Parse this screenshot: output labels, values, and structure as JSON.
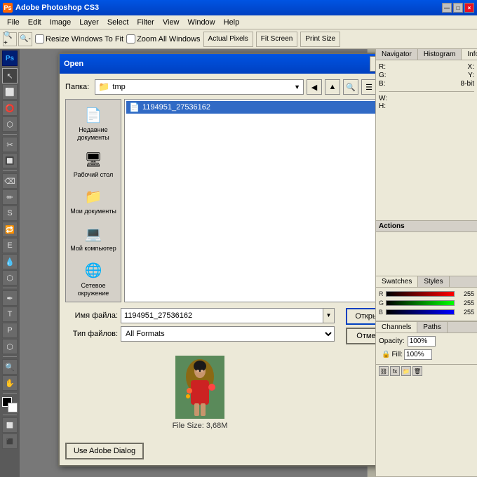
{
  "window": {
    "title": "Adobe Photoshop CS3",
    "close": "×",
    "minimize": "—",
    "maximize": "□"
  },
  "menu": {
    "items": [
      "File",
      "Edit",
      "Image",
      "Layer",
      "Select",
      "Filter",
      "View",
      "Window",
      "Help"
    ]
  },
  "toolbar": {
    "zoom_options": [
      "Resize Windows To Fit",
      "Zoom All Windows"
    ],
    "buttons": [
      "Actual Pixels",
      "Fit Screen",
      "Print Size"
    ]
  },
  "dialog": {
    "title": "Open",
    "help_btn": "?",
    "close_btn": "×",
    "folder_label": "Папка:",
    "folder_name": "tmp",
    "file_name_label": "Имя файла:",
    "file_type_label": "Тип файлов:",
    "file_name_value": "1194951_27536162",
    "file_type_value": "All Formats",
    "open_btn": "Открыть",
    "cancel_btn": "Отмена",
    "file_item": "1194951_27536162",
    "file_size": "File Size: 3,68M",
    "use_adobe_btn": "Use Adobe Dialog"
  },
  "places": [
    {
      "label": "Недавние документы",
      "icon": "📄"
    },
    {
      "label": "Рабочий стол",
      "icon": "🖥"
    },
    {
      "label": "Мои документы",
      "icon": "📁"
    },
    {
      "label": "Мой компьютер",
      "icon": "💻"
    },
    {
      "label": "Сетевое окружение",
      "icon": "🌐"
    }
  ],
  "right_panels": {
    "tabs": [
      "Navigator",
      "Histogram",
      "Info"
    ],
    "active_tab": "Info",
    "info": {
      "r_label": "R:",
      "g_label": "G:",
      "b_label": "B:",
      "mode": "8-bit",
      "w_label": "W:",
      "h_label": "H:"
    }
  },
  "color_panel": {
    "tabs": [
      "Swatches",
      "Styles"
    ],
    "r_value": "255",
    "g_value": "255",
    "b_value": "255"
  },
  "actions_panel": {
    "label": "Actions"
  },
  "channels_panel": {
    "tabs": [
      "Channels",
      "Paths"
    ],
    "opacity_label": "Opacity:",
    "opacity_value": "100%",
    "fill_label": "Fill:",
    "fill_value": "100%"
  },
  "tools": [
    "↖",
    "✂",
    "⬡",
    "⬡",
    "✒",
    "✏",
    "S",
    "E",
    "⌫",
    "🪣",
    "T",
    "P",
    "🔍",
    "✋",
    "⬜",
    "⭕",
    "🔲",
    "🖊",
    "🔁",
    "💧"
  ],
  "status_bar": {
    "icons": [
      "⛓",
      "fx",
      "🔒",
      "📁",
      "🗑"
    ]
  }
}
